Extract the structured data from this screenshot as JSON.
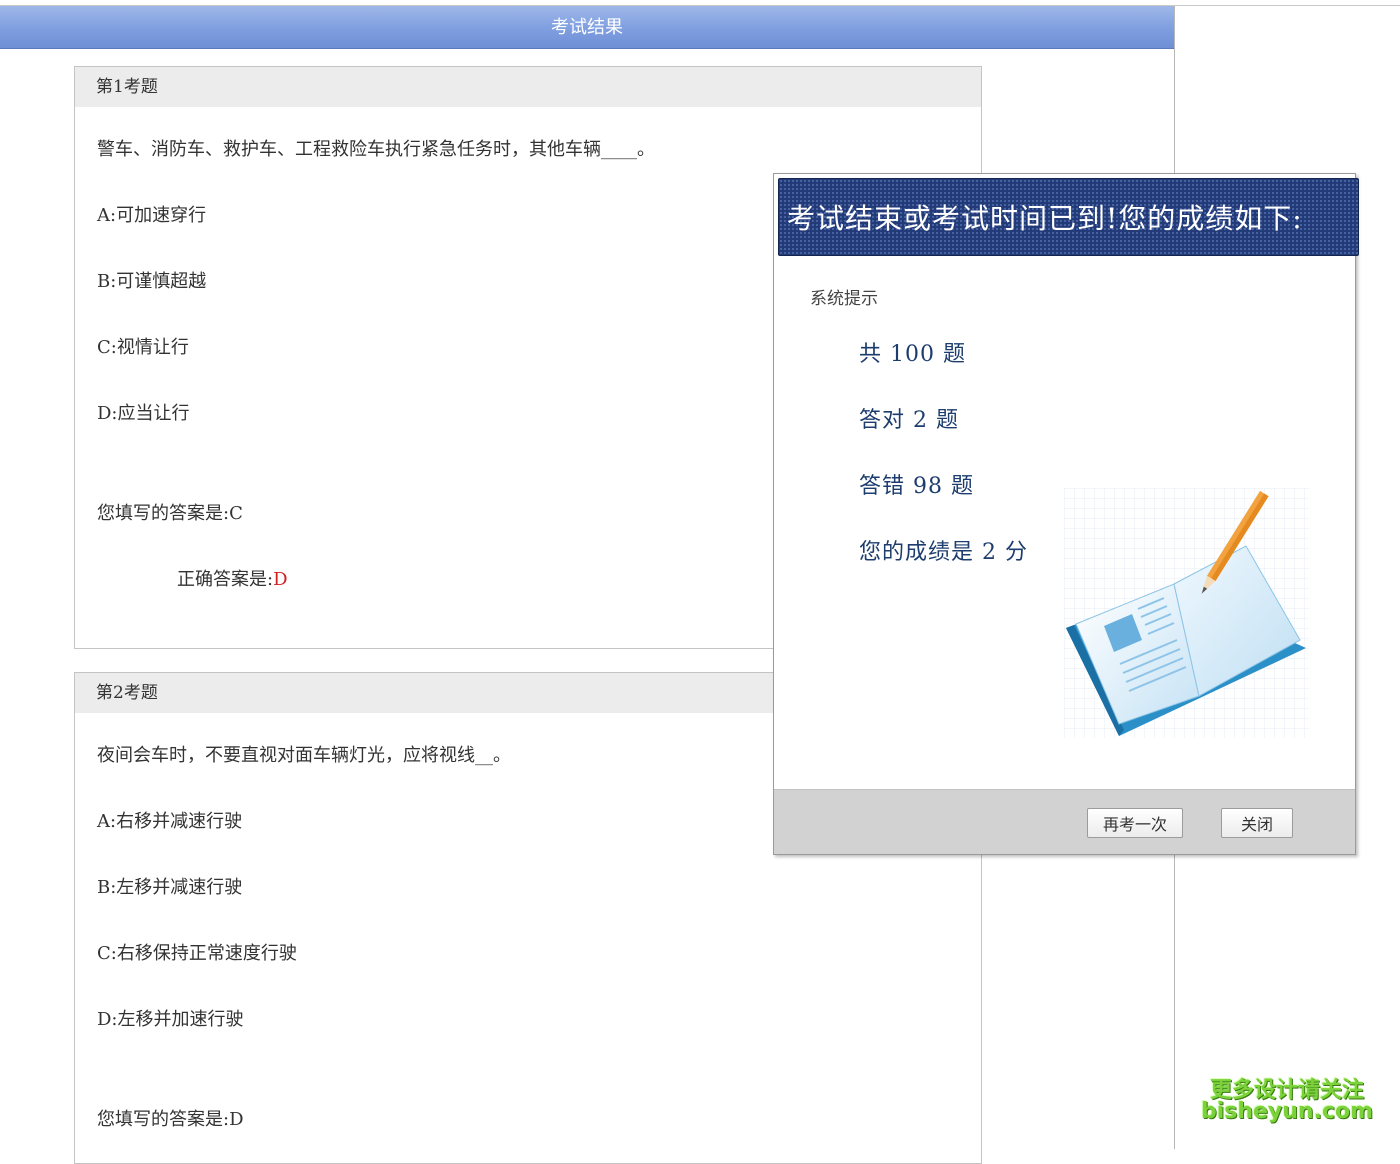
{
  "page": {
    "title": "考试结果"
  },
  "questions": [
    {
      "header": "第1考题",
      "question": "警车、消防车、救护车、工程救险车执行紧急任务时，其他车辆____。",
      "options": [
        "A:可加速穿行",
        "B:可谨慎超越",
        "C:视情让行",
        "D:应当让行"
      ],
      "user_answer_label": "您填写的答案是:",
      "user_answer": "C",
      "correct_answer_label": "正确答案是:",
      "correct_answer": "D"
    },
    {
      "header": "第2考题",
      "question": "夜间会车时，不要直视对面车辆灯光，应将视线__。",
      "options": [
        "A:右移并减速行驶",
        "B:左移并减速行驶",
        "C:右移保持正常速度行驶",
        "D:左移并加速行驶"
      ],
      "user_answer_label": "您填写的答案是:",
      "user_answer": "D"
    }
  ],
  "dialog": {
    "heading": "考试结束或考试时间已到!您的成绩如下:",
    "system_tip": "系统提示",
    "total_line": "共  100  题",
    "correct_line": "答对  2  题",
    "wrong_line": "答错  98  题",
    "score_line": "您的成绩是  2  分",
    "retry_button": "再考一次",
    "close_button": "关闭",
    "illustration": "open-book-with-pencil-icon"
  },
  "watermark": {
    "line1": "更多设计请关注",
    "line2": "bisheyun.com"
  },
  "colors": {
    "titlebar": "#7f9ee0",
    "dialog_header": "#233a78",
    "correct_answer": "#d12020",
    "score_text": "#1d3d6e",
    "watermark": "#7bd23a"
  }
}
